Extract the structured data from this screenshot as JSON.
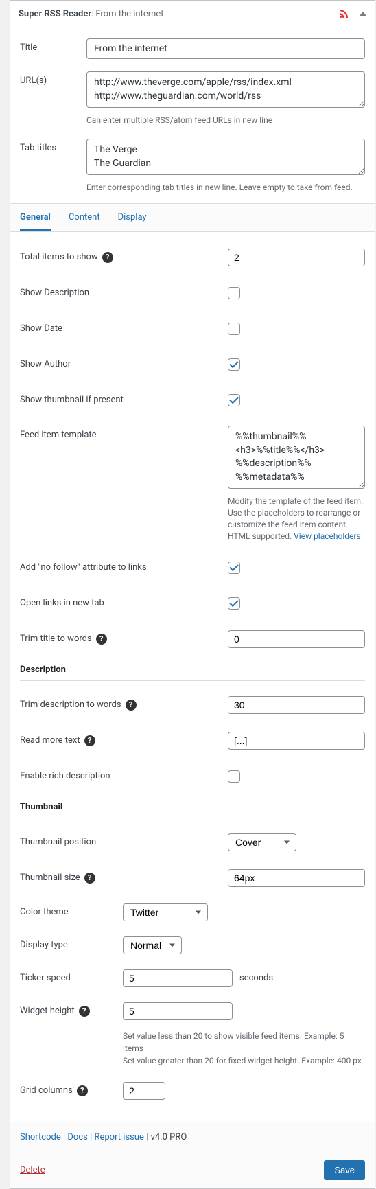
{
  "header": {
    "title_bold": "Super RSS Reader",
    "title_sub": ": From the internet"
  },
  "fields": {
    "title_label": "Title",
    "title_value": "From the internet",
    "urls_label": "URL(s)",
    "urls_value": "http://www.theverge.com/apple/rss/index.xml\nhttp://www.theguardian.com/world/rss",
    "urls_help": "Can enter multiple RSS/atom feed URLs in new line",
    "tabtitles_label": "Tab titles",
    "tabtitles_value": "The Verge\nThe Guardian",
    "tabtitles_help": "Enter corresponding tab titles in new line. Leave empty to take from feed."
  },
  "tabs": {
    "general": "General",
    "content": "Content",
    "display": "Display"
  },
  "settings": {
    "total_items_label": "Total items to show",
    "total_items_value": "2",
    "show_desc_label": "Show Description",
    "show_date_label": "Show Date",
    "show_author_label": "Show Author",
    "show_thumb_label": "Show thumbnail if present",
    "feed_template_label": "Feed item template",
    "feed_template_value": "%%thumbnail%%\n<h3>%%title%%</h3>\n%%description%%\n%%metadata%%",
    "feed_template_help": "Modify the template of the feed item. Use the placeholders to rearrange or customize the feed item content. HTML supported. ",
    "feed_template_link": "View placeholders",
    "nofollow_label": "Add \"no follow\" attribute to links",
    "newtab_label": "Open links in new tab",
    "trim_title_label": "Trim title to words",
    "trim_title_value": "0",
    "desc_heading": "Description",
    "trim_desc_label": "Trim description to words",
    "trim_desc_value": "30",
    "readmore_label": "Read more text",
    "readmore_value": "[...]",
    "richdesc_label": "Enable rich description",
    "thumb_heading": "Thumbnail",
    "thumb_pos_label": "Thumbnail position",
    "thumb_pos_value": "Cover",
    "thumb_size_label": "Thumbnail size",
    "thumb_size_value": "64px",
    "color_theme_label": "Color theme",
    "color_theme_value": "Twitter",
    "display_type_label": "Display type",
    "display_type_value": "Normal",
    "ticker_speed_label": "Ticker speed",
    "ticker_speed_value": "5",
    "ticker_speed_suffix": "seconds",
    "widget_height_label": "Widget height",
    "widget_height_value": "5",
    "widget_height_help1": "Set value less than 20 to show visible feed items. Example: 5 items",
    "widget_height_help2": "Set value greater than 20 for fixed widget height. Example: 400 px",
    "grid_cols_label": "Grid columns",
    "grid_cols_value": "2"
  },
  "footer": {
    "shortcode": "Shortcode",
    "docs": "Docs",
    "report": "Report issue",
    "version": "v4.0 PRO",
    "delete": "Delete",
    "save": "Save"
  }
}
